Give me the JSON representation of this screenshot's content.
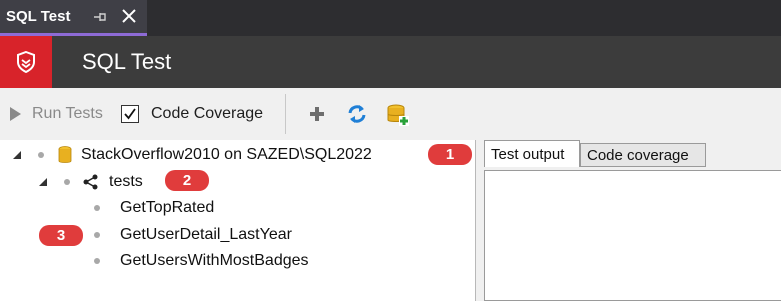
{
  "document_tab": {
    "title": "SQL Test"
  },
  "header": {
    "title": "SQL Test"
  },
  "toolbar": {
    "run_tests_label": "Run Tests",
    "code_coverage_label": "Code Coverage",
    "code_coverage_checked": true,
    "icons": [
      "add-icon",
      "refresh-icon",
      "add-database-icon"
    ]
  },
  "tree": {
    "database": {
      "label": "StackOverflow2010 on SAZED\\SQL2022",
      "badge": "1"
    },
    "schema": {
      "label": "tests",
      "badge": "2"
    },
    "tests": [
      {
        "label": "GetTopRated"
      },
      {
        "label": "GetUserDetail_LastYear",
        "badge": "3"
      },
      {
        "label": "GetUsersWithMostBadges"
      }
    ]
  },
  "right_panel": {
    "tabs": [
      {
        "label": "Test output",
        "active": true
      },
      {
        "label": "Code coverage",
        "active": false
      }
    ]
  },
  "colors": {
    "accent": "#8e6bd6",
    "brand_red": "#d8232a",
    "badge_red": "#e03c3c",
    "header_bg": "#3c3c3c"
  }
}
